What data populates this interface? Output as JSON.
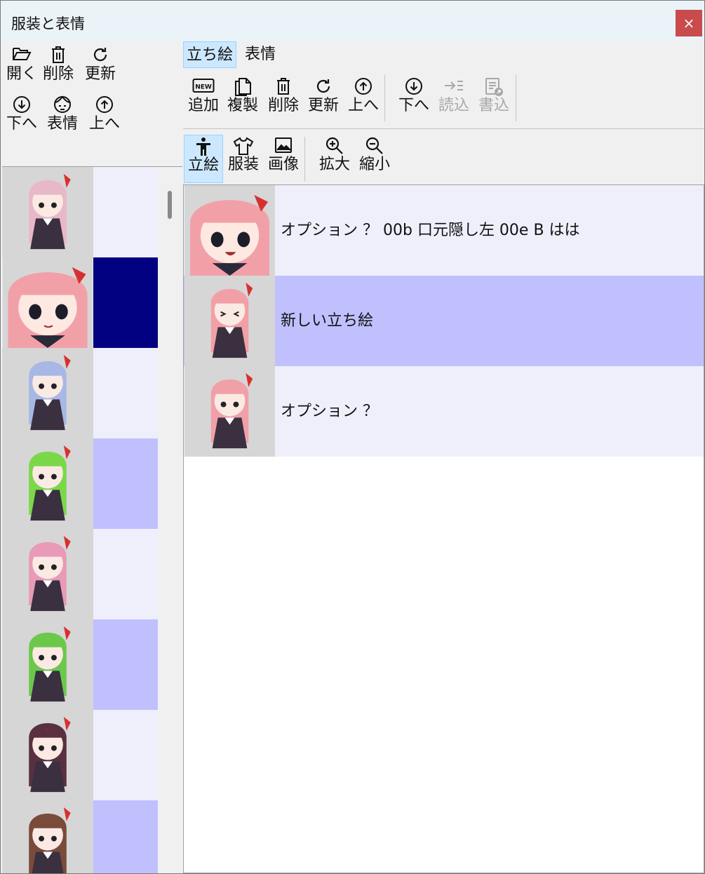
{
  "window": {
    "title": "服装と表情",
    "close_icon": "×"
  },
  "left_toolbar": {
    "row1": [
      {
        "name": "open-button",
        "icon": "folder-open-icon",
        "label": "開く"
      },
      {
        "name": "delete-button",
        "icon": "trash-icon",
        "label": "削除"
      },
      {
        "name": "refresh-button",
        "icon": "refresh-icon",
        "label": "更新"
      }
    ],
    "row2": [
      {
        "name": "move-down-button",
        "icon": "circle-arrow-down-icon",
        "label": "下へ"
      },
      {
        "name": "expression-button",
        "icon": "face-icon",
        "label": "表情"
      },
      {
        "name": "move-up-button",
        "icon": "circle-arrow-up-icon",
        "label": "上へ"
      }
    ]
  },
  "tabs": [
    {
      "label": "立ち絵",
      "selected": true
    },
    {
      "label": "表情",
      "selected": false
    }
  ],
  "main_toolbar": [
    {
      "name": "add-button",
      "icon": "new-badge-icon",
      "label": "追加",
      "disabled": false
    },
    {
      "name": "duplicate-button",
      "icon": "copy-icon",
      "label": "複製",
      "disabled": false
    },
    {
      "name": "delete-button",
      "icon": "trash-icon",
      "label": "削除",
      "disabled": false
    },
    {
      "name": "refresh-button",
      "icon": "refresh-icon",
      "label": "更新",
      "disabled": false
    },
    {
      "name": "move-up-button",
      "icon": "circle-arrow-up-icon",
      "label": "上へ",
      "disabled": false
    },
    {
      "name": "move-down-button",
      "icon": "circle-arrow-down-icon",
      "label": "下へ",
      "disabled": false
    },
    {
      "name": "import-button",
      "icon": "import-arrow-icon",
      "label": "読込",
      "disabled": true
    },
    {
      "name": "export-button",
      "icon": "document-export-icon",
      "label": "書込",
      "disabled": true
    }
  ],
  "view_toolbar": [
    {
      "name": "standing-view-button",
      "icon": "person-icon",
      "label": "立絵",
      "active": true
    },
    {
      "name": "costume-view-button",
      "icon": "shirt-icon",
      "label": "服装",
      "active": false
    },
    {
      "name": "image-view-button",
      "icon": "image-icon",
      "label": "画像",
      "active": false
    },
    {
      "name": "zoom-in-button",
      "icon": "zoom-in-icon",
      "label": "拡大",
      "active": false
    },
    {
      "name": "zoom-out-button",
      "icon": "zoom-out-icon",
      "label": "縮小",
      "active": false
    }
  ],
  "character_list": [
    {
      "hair_color": "#e8b8c8",
      "cell_color": "#efeffc",
      "selected": false
    },
    {
      "hair_color": "#f2a0a8",
      "cell_color": "#000080",
      "selected": true
    },
    {
      "hair_color": "#a8b8e6",
      "cell_color": "#efeffc",
      "selected": false
    },
    {
      "hair_color": "#7ad848",
      "cell_color": "#c0c0ff",
      "selected": false
    },
    {
      "hair_color": "#e89ab8",
      "cell_color": "#efeffc",
      "selected": false
    },
    {
      "hair_color": "#6cc84a",
      "cell_color": "#c0c0ff",
      "selected": false
    },
    {
      "hair_color": "#5a3040",
      "cell_color": "#efeffc",
      "selected": false
    },
    {
      "hair_color": "#7a4a3a",
      "cell_color": "#c0c0ff",
      "selected": false
    }
  ],
  "costume_list": [
    {
      "text": "オプション ？ 00b 口元隠し左 00e B はは",
      "bg": "#efeffc",
      "face": "open"
    },
    {
      "text": "新しい立ち絵",
      "bg": "#c0c0ff",
      "face": "closed"
    },
    {
      "text": "オプション ？",
      "bg": "#efeffc",
      "face": "normal"
    }
  ]
}
